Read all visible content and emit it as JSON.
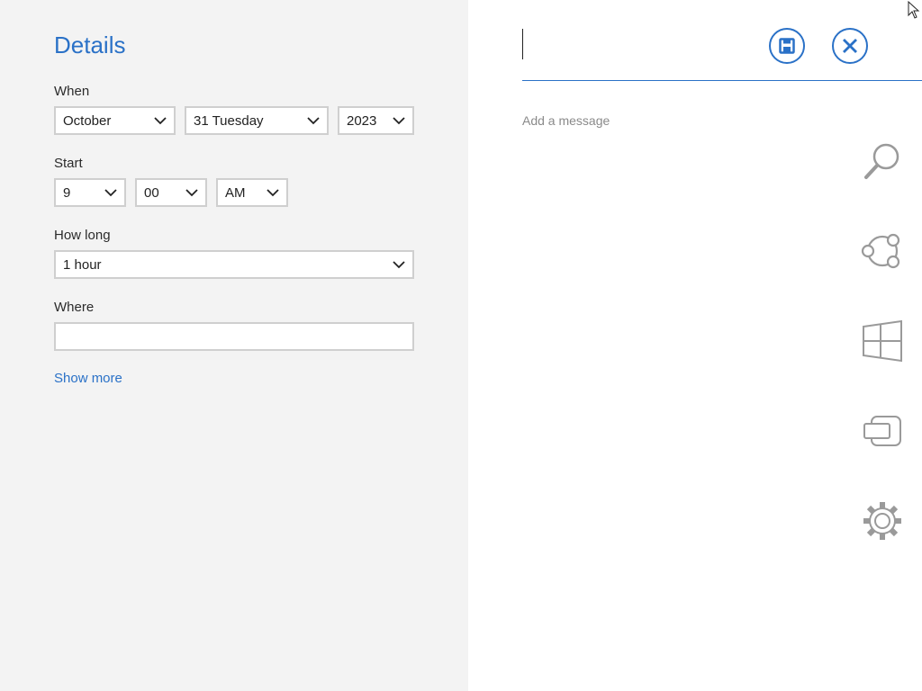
{
  "details": {
    "title": "Details",
    "when_label": "When",
    "month": "October",
    "day": "31 Tuesday",
    "year": "2023",
    "start_label": "Start",
    "hour": "9",
    "minute": "00",
    "ampm": "AM",
    "howlong_label": "How long",
    "duration": "1 hour",
    "where_label": "Where",
    "where_value": "",
    "show_more": "Show more"
  },
  "event": {
    "title_value": "",
    "message_placeholder": "Add a message"
  },
  "colors": {
    "accent": "#2a71c7",
    "panel": "#f3f3f3",
    "border": "#cfcfcf"
  },
  "charms": [
    "search-icon",
    "share-icon",
    "start-icon",
    "devices-icon",
    "settings-icon"
  ]
}
